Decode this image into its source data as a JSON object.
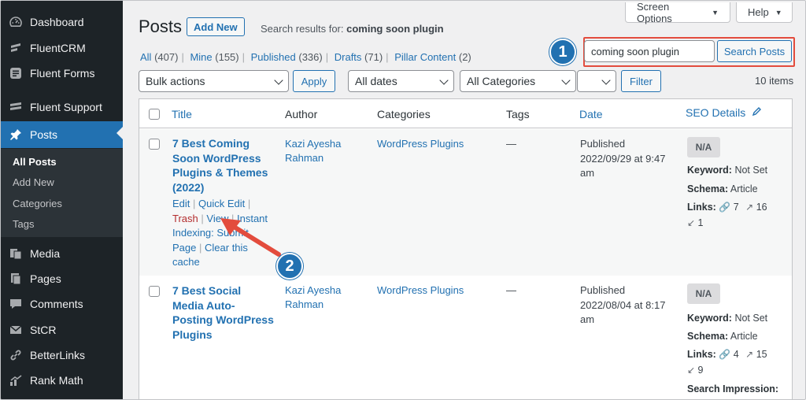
{
  "sidebar": {
    "items": [
      {
        "label": "Dashboard",
        "icon": "dashboard-icon"
      },
      {
        "label": "FluentCRM",
        "icon": "fluentcrm-icon"
      },
      {
        "label": "Fluent Forms",
        "icon": "fluent-forms-icon"
      },
      {
        "label": "Fluent Support",
        "icon": "fluent-support-icon"
      },
      {
        "label": "Posts",
        "icon": "pin-icon"
      },
      {
        "label": "Media",
        "icon": "media-icon"
      },
      {
        "label": "Pages",
        "icon": "pages-icon"
      },
      {
        "label": "Comments",
        "icon": "comments-icon"
      },
      {
        "label": "StCR",
        "icon": "mail-icon"
      },
      {
        "label": "BetterLinks",
        "icon": "link-icon"
      },
      {
        "label": "Rank Math",
        "icon": "chart-icon"
      }
    ],
    "submenu": [
      "All Posts",
      "Add New",
      "Categories",
      "Tags"
    ]
  },
  "header": {
    "screen_options": "Screen Options",
    "help": "Help",
    "title": "Posts",
    "add_new": "Add New",
    "search_results_prefix": "Search results for:",
    "search_term": "coming soon plugin"
  },
  "views": [
    {
      "label": "All",
      "count": "(407)"
    },
    {
      "label": "Mine",
      "count": "(155)"
    },
    {
      "label": "Published",
      "count": "(336)"
    },
    {
      "label": "Drafts",
      "count": "(71)"
    },
    {
      "label": "Pillar Content",
      "count": "(2)"
    }
  ],
  "search": {
    "value": "coming soon plugin",
    "button": "Search Posts"
  },
  "filters": {
    "bulk_actions": "Bulk actions",
    "apply": "Apply",
    "dates": "All dates",
    "categories": "All Categories",
    "filter": "Filter",
    "items_count": "10 items"
  },
  "table": {
    "columns": {
      "title": "Title",
      "author": "Author",
      "categories": "Categories",
      "tags": "Tags",
      "date": "Date",
      "seo": "SEO Details"
    },
    "rows": [
      {
        "title": "7 Best Coming Soon WordPress Plugins & Themes (2022)",
        "actions": {
          "edit": "Edit",
          "quick_edit": "Quick Edit",
          "trash": "Trash",
          "view": "View",
          "instant_indexing": "Instant Indexing: Submit Page",
          "clear_cache": "Clear this cache"
        },
        "author": "Kazi Ayesha Rahman",
        "category": "WordPress Plugins",
        "tags": "—",
        "status": "Published",
        "date": "2022/09/29 at 9:47 am",
        "seo_score": "N/A",
        "keyword": "Not Set",
        "schema": "Article",
        "internal_links": "7",
        "external_links": "16",
        "incoming_links": "1"
      },
      {
        "title": "7 Best Social Media Auto-Posting WordPress Plugins",
        "author": "Kazi Ayesha Rahman",
        "category": "WordPress Plugins",
        "tags": "—",
        "status": "Published",
        "date": "2022/08/04 at 8:17 am",
        "seo_score": "N/A",
        "keyword": "Not Set",
        "schema": "Article",
        "internal_links": "4",
        "external_links": "15",
        "incoming_links": "9",
        "search_impression_label": "Search Impression:"
      }
    ]
  },
  "seo_labels": {
    "keyword": "Keyword:",
    "schema": "Schema:",
    "links": "Links:"
  },
  "annotations": {
    "badge1": "1",
    "badge2": "2",
    "highlight_color": "#e34c3d",
    "accent": "#2271b1"
  }
}
